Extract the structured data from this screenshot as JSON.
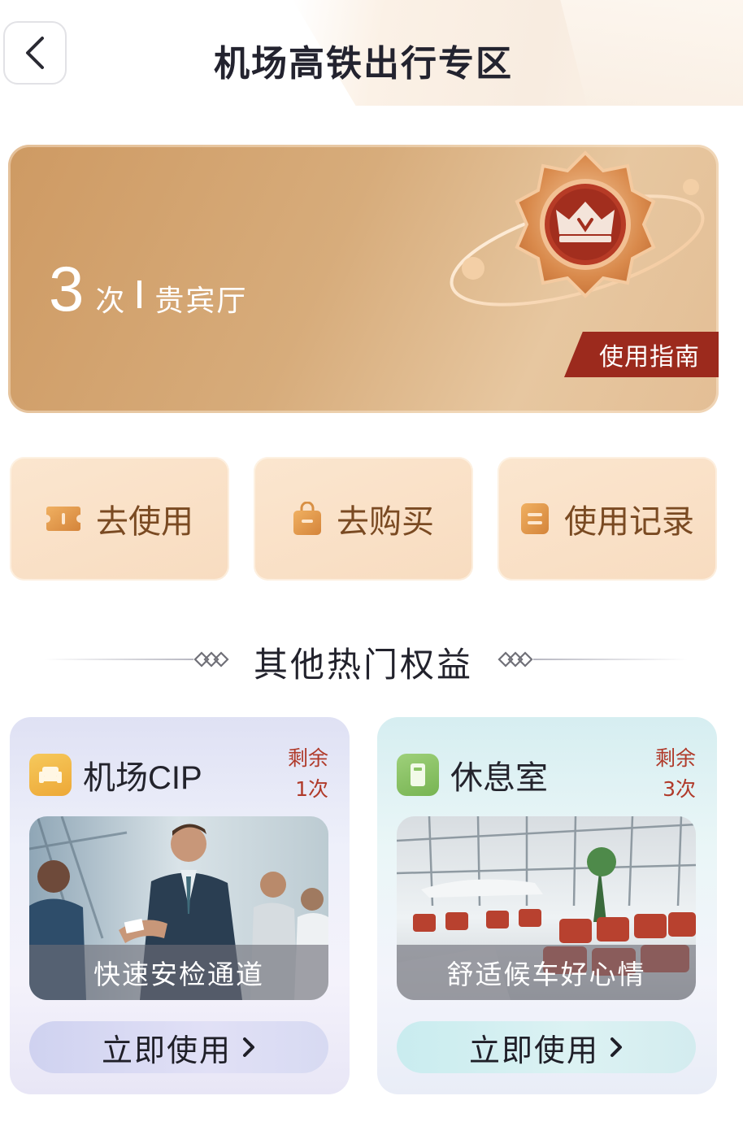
{
  "header": {
    "title": "机场高铁出行专区",
    "back_icon": "chevron-left-icon"
  },
  "hero": {
    "count": "3",
    "unit": "次",
    "type_label": "贵宾厅",
    "guide_label": "使用指南",
    "badge_icon": "crown-medal-icon"
  },
  "actions": [
    {
      "label": "去使用",
      "icon": "ticket-icon"
    },
    {
      "label": "去购买",
      "icon": "shopping-bag-icon"
    },
    {
      "label": "使用记录",
      "icon": "record-icon"
    }
  ],
  "section": {
    "title": "其他热门权益"
  },
  "benefits": [
    {
      "title": "机场CIP",
      "icon": "sofa-icon",
      "icon_color": "#f1b84a",
      "remain_label": "剩余",
      "remain_count": "1次",
      "caption": "快速安检通道",
      "button_label": "立即使用"
    },
    {
      "title": "休息室",
      "icon": "door-icon",
      "icon_color": "#8cc466",
      "remain_label": "剩余",
      "remain_count": "3次",
      "caption": "舒适候车好心情",
      "button_label": "立即使用"
    }
  ],
  "colors": {
    "accent_red": "#9c2a1d",
    "gold": "#d7ac7b",
    "remain_red": "#b03a2a"
  }
}
